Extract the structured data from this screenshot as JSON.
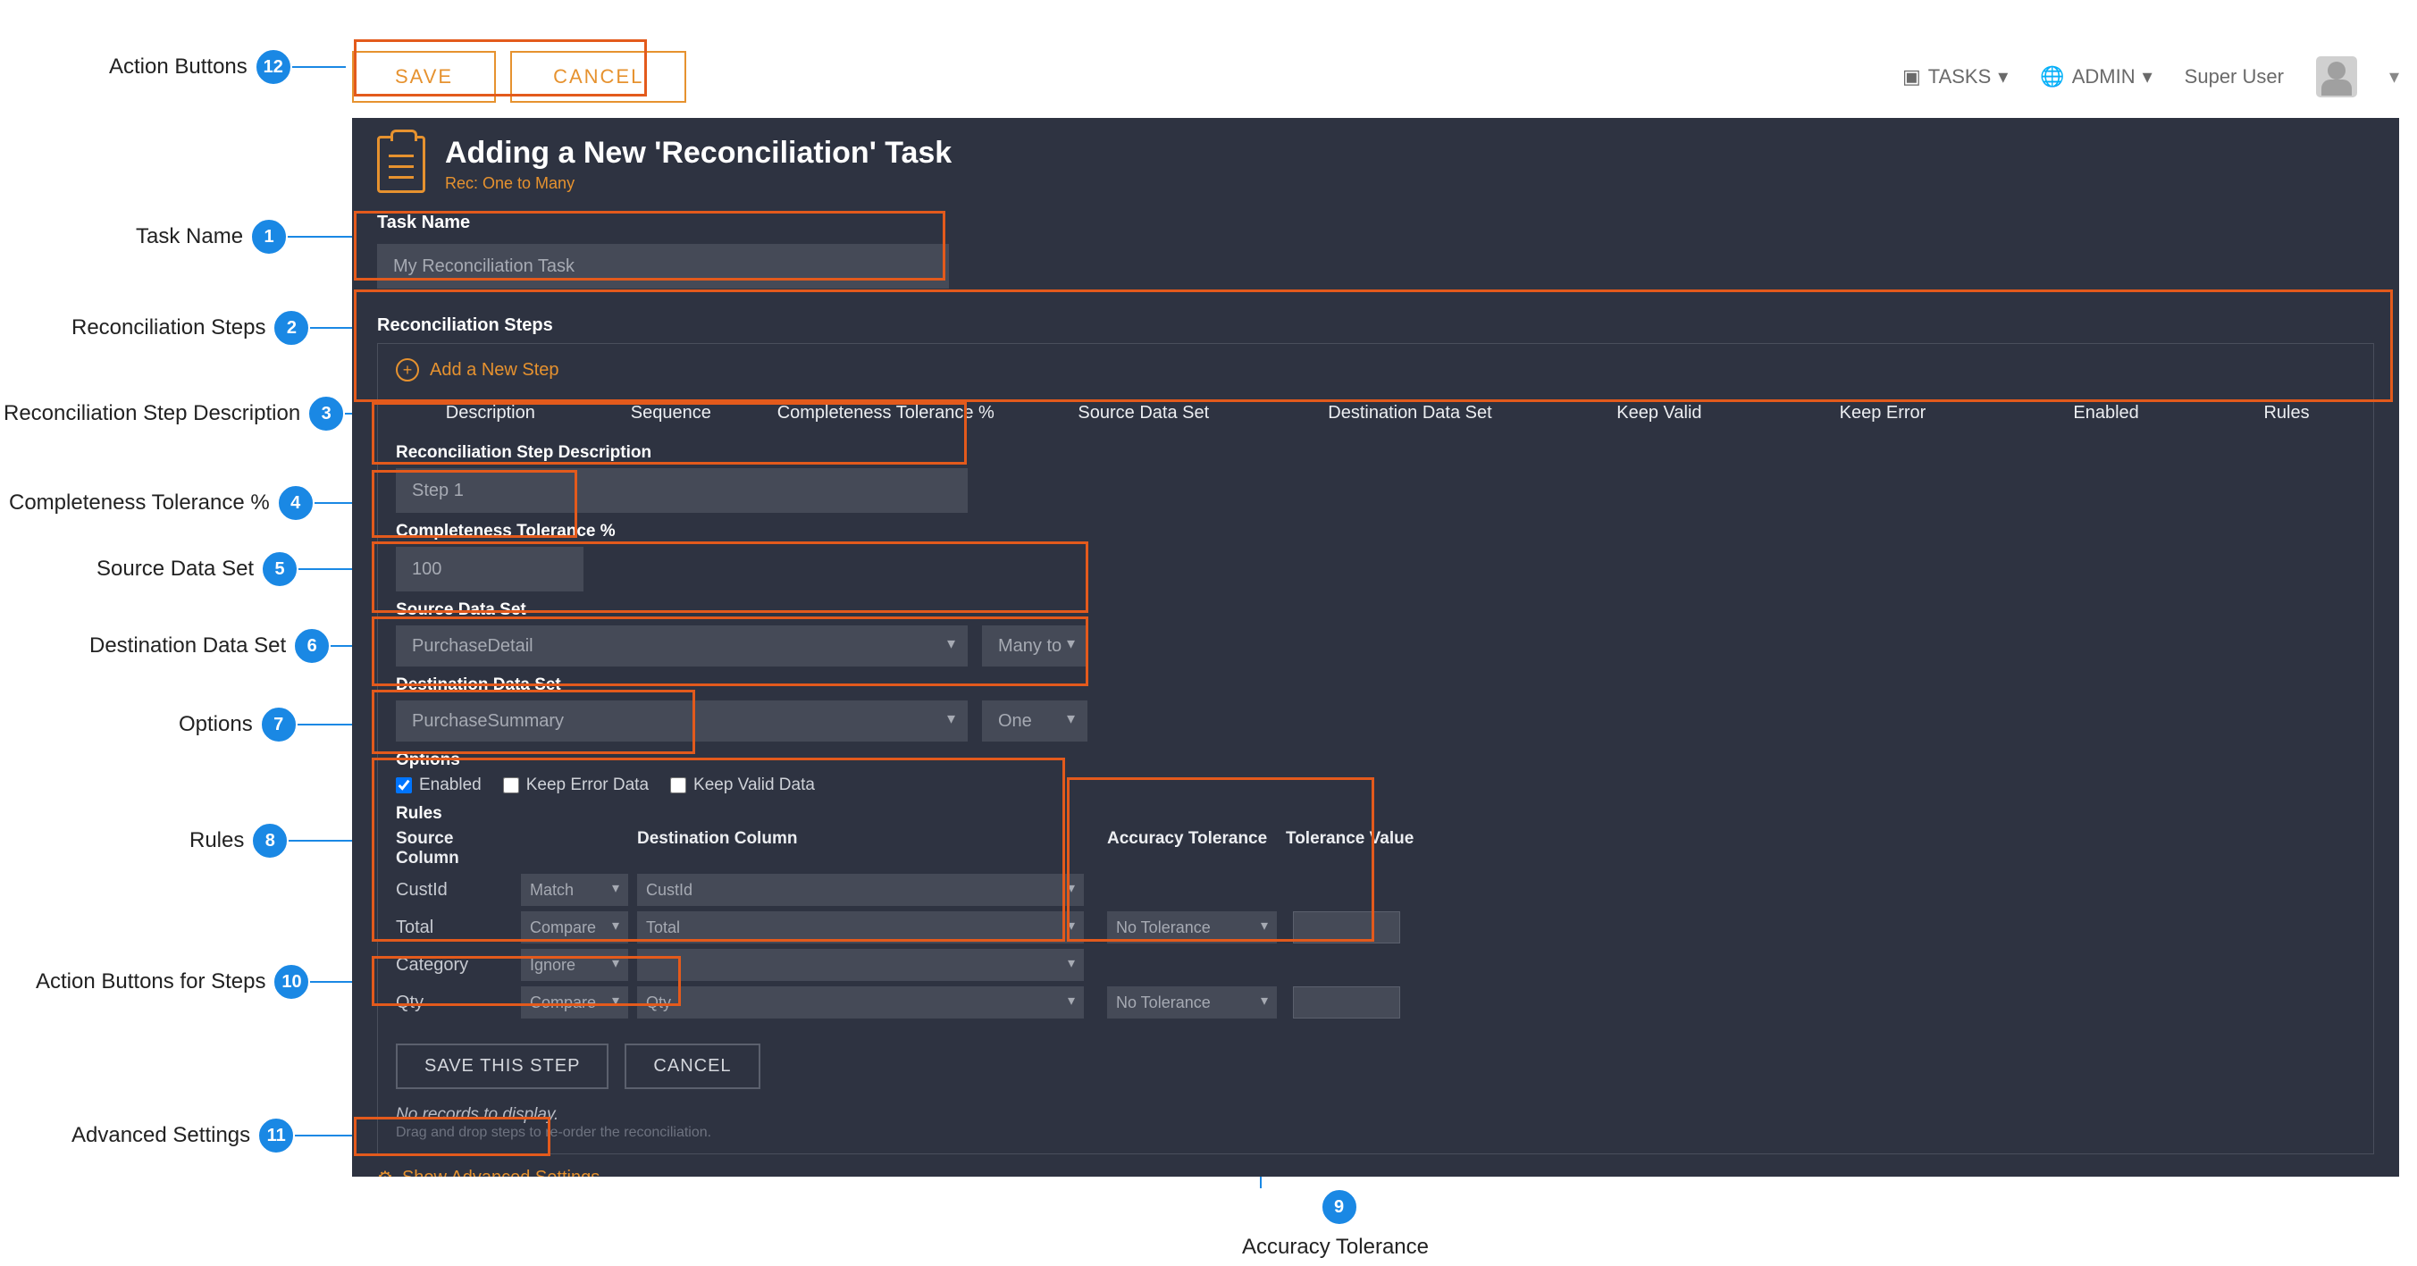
{
  "callouts": {
    "c12": "Action Buttons",
    "c1": "Task Name",
    "c2": "Reconciliation Steps",
    "c3": "Reconciliation Step Description",
    "c4": "Completeness Tolerance %",
    "c5": "Source Data Set",
    "c6": "Destination Data Set",
    "c7": "Options",
    "c8": "Rules",
    "c10": "Action Buttons for Steps",
    "c11": "Advanced Settings",
    "c9": "Accuracy Tolerance"
  },
  "topbar": {
    "save": "SAVE",
    "cancel": "CANCEL",
    "tasks": "TASKS",
    "admin": "ADMIN",
    "user": "Super User"
  },
  "header": {
    "title": "Adding a New 'Reconciliation' Task",
    "subtitle": "Rec: One to Many"
  },
  "taskName": {
    "label": "Task Name",
    "value": "My Reconciliation Task"
  },
  "recon": {
    "header": "Reconciliation Steps",
    "addStep": "Add a New Step",
    "cols": {
      "desc": "Description",
      "seq": "Sequence",
      "comp": "Completeness Tolerance %",
      "src": "Source Data Set",
      "dst": "Destination Data Set",
      "kv": "Keep Valid",
      "ke": "Keep Error",
      "en": "Enabled",
      "rules": "Rules"
    }
  },
  "step": {
    "descLabel": "Reconciliation Step Description",
    "descValue": "Step 1",
    "compLabel": "Completeness Tolerance %",
    "compValue": "100",
    "srcLabel": "Source Data Set",
    "srcValue": "PurchaseDetail",
    "srcMode": "Many to",
    "dstLabel": "Destination Data Set",
    "dstValue": "PurchaseSummary",
    "dstMode": "One",
    "optLabel": "Options",
    "optEnabled": "Enabled",
    "optKeepErr": "Keep Error Data",
    "optKeepValid": "Keep Valid Data",
    "rulesLabel": "Rules",
    "ruleCols": {
      "src": "Source Column",
      "dst": "Destination Column",
      "acc": "Accuracy Tolerance",
      "tol": "Tolerance Value"
    },
    "rows": [
      {
        "src": "CustId",
        "mode": "Match",
        "dst": "CustId",
        "acc": "",
        "tol": ""
      },
      {
        "src": "Total",
        "mode": "Compare",
        "dst": "Total",
        "acc": "No Tolerance",
        "tol": ""
      },
      {
        "src": "Category",
        "mode": "Ignore",
        "dst": "",
        "acc": "",
        "tol": ""
      },
      {
        "src": "Qty",
        "mode": "Compare",
        "dst": "Qty",
        "acc": "No Tolerance",
        "tol": ""
      }
    ],
    "saveStep": "SAVE THIS STEP",
    "cancelStep": "CANCEL"
  },
  "footer": {
    "noRecords": "No records to display.",
    "dragNote": "Drag and drop steps to re-order the reconciliation.",
    "advanced": "Show Advanced Settings"
  }
}
